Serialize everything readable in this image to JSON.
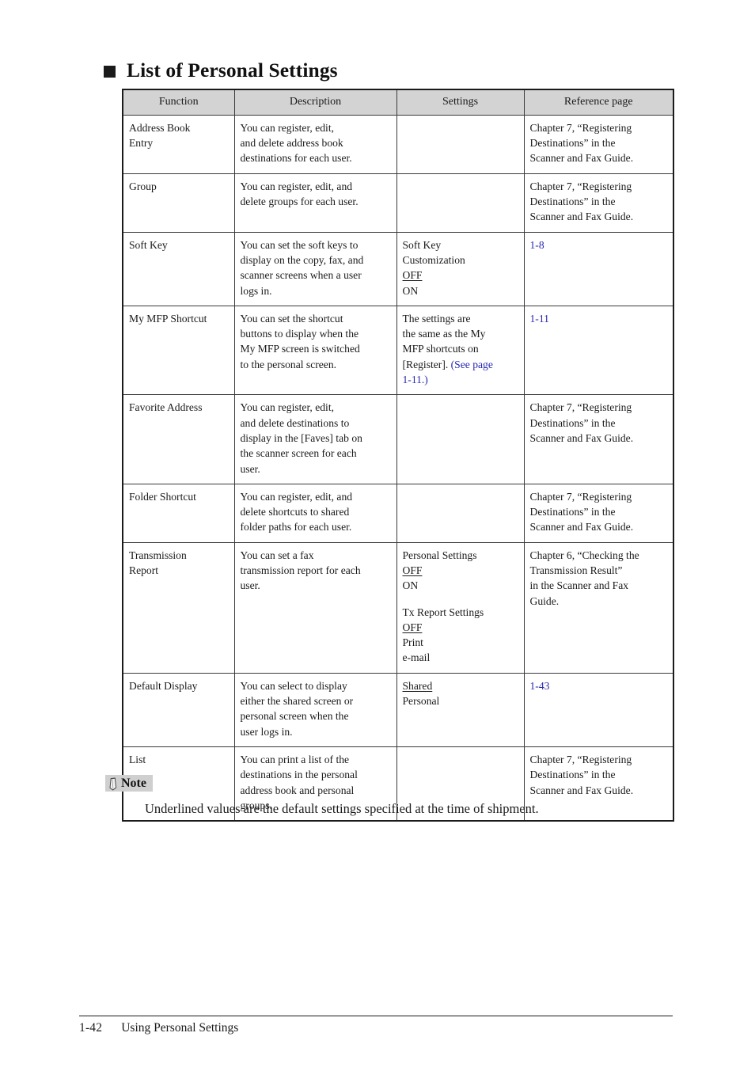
{
  "page": {
    "title": "List of Personal Settings",
    "bullet_icon": "black-square-bullet"
  },
  "table": {
    "headers": [
      "Function",
      "Description",
      "Settings",
      "Reference page"
    ],
    "rows": [
      {
        "function": "Address Book\nEntry",
        "description": "You can register, edit,\nand delete address book\ndestinations for each user.",
        "settings_lines": [],
        "reference": "Chapter 7, “Registering\nDestinations” in the\nScanner and Fax Guide.",
        "reference_link": ""
      },
      {
        "function": "Group",
        "description": "You can register, edit, and\ndelete groups for each user.",
        "settings_lines": [],
        "reference": "Chapter 7, “Registering\nDestinations” in the\nScanner and Fax Guide.",
        "reference_link": ""
      },
      {
        "function": "Soft Key",
        "description": "You can set the soft keys to\ndisplay on the copy, fax, and\nscanner screens when a user\nlogs in.",
        "settings_lines": [
          {
            "text": "Soft Key",
            "style": "plain"
          },
          {
            "text": "Customization",
            "style": "plain"
          },
          {
            "text": "OFF",
            "style": "underline"
          },
          {
            "text": "ON",
            "style": "plain"
          }
        ],
        "reference": "",
        "reference_link": "1-8"
      },
      {
        "function": "My MFP Shortcut",
        "description": "You can set the shortcut\nbuttons to display when the\nMy MFP screen is switched\nto the personal screen.",
        "settings_lines": [
          {
            "text": "The settings are",
            "style": "plain"
          },
          {
            "text": "the same as the My",
            "style": "plain"
          },
          {
            "text": "MFP shortcuts on",
            "style": "plain"
          },
          {
            "text": "[Register]. ",
            "style": "plain",
            "link_suffix": "(See page"
          },
          {
            "text": "",
            "style": "plain",
            "link_suffix": "1-11.)"
          }
        ],
        "reference": "",
        "reference_link": "1-11"
      },
      {
        "function": "Favorite Address",
        "description": "You can register, edit,\nand delete destinations to\ndisplay in the [Faves] tab on\nthe scanner screen for each\nuser.",
        "settings_lines": [],
        "reference": "Chapter 7, “Registering\nDestinations” in the\nScanner and Fax Guide.",
        "reference_link": ""
      },
      {
        "function": "Folder Shortcut",
        "description": "You can register, edit, and\ndelete shortcuts to shared\nfolder paths for each user.",
        "settings_lines": [],
        "reference": "Chapter 7, “Registering\nDestinations” in the\nScanner and Fax Guide.",
        "reference_link": ""
      },
      {
        "function": "Transmission\nReport",
        "description": "You can set a fax\ntransmission report for each\nuser.",
        "settings_lines": [
          {
            "text": "Personal Settings",
            "style": "plain"
          },
          {
            "text": "OFF",
            "style": "underline"
          },
          {
            "text": "ON",
            "style": "plain"
          },
          {
            "text": "",
            "style": "gap"
          },
          {
            "text": "Tx Report Settings",
            "style": "plain"
          },
          {
            "text": "OFF",
            "style": "underline"
          },
          {
            "text": "Print",
            "style": "plain"
          },
          {
            "text": "e-mail",
            "style": "plain"
          }
        ],
        "reference": "Chapter 6, “Checking the\nTransmission Result”\nin the Scanner and Fax\nGuide.",
        "reference_link": ""
      },
      {
        "function": "Default Display",
        "description": "You can select to display\neither the shared screen or\npersonal screen when the\nuser logs in.",
        "settings_lines": [
          {
            "text": "Shared",
            "style": "underline"
          },
          {
            "text": "Personal",
            "style": "plain"
          }
        ],
        "reference": "",
        "reference_link": "1-43"
      },
      {
        "function": "List",
        "description": "You can print a list of the\ndestinations in the personal\naddress book and personal\ngroups.",
        "settings_lines": [],
        "reference": "Chapter 7, “Registering\nDestinations” in the\nScanner and Fax Guide.",
        "reference_link": ""
      }
    ]
  },
  "note": {
    "icon": "note-pencil-icon",
    "label": "Note",
    "text": "Underlined values are the default settings specified at the time of shipment."
  },
  "footer": {
    "page_number": "1-42",
    "section": "Using Personal Settings"
  },
  "colors": {
    "header_fill": "#d3d3d3",
    "link": "#2727b0",
    "rule": "#1a1a1a",
    "note_badge": "#cfcfcf"
  }
}
